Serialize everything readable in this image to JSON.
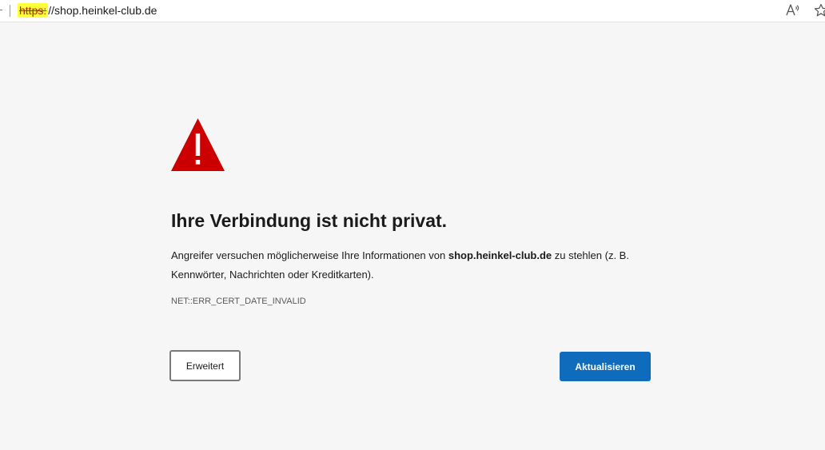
{
  "address_bar": {
    "url_scheme": "https:",
    "url_rest": "//shop.heinkel-club.de",
    "icons": [
      "read-aloud-icon",
      "favorite-star-icon"
    ]
  },
  "warning": {
    "icon": "warning-triangle-icon",
    "icon_color": "#cc0000",
    "title": "Ihre Verbindung ist nicht privat.",
    "description_before": "Angreifer versuchen möglicherweise Ihre Informationen von ",
    "description_domain": "shop.heinkel-club.de",
    "description_after": " zu stehlen (z. B. Kennwörter, Nachrichten oder Kreditkarten).",
    "error_code": "NET::ERR_CERT_DATE_INVALID"
  },
  "buttons": {
    "advanced_label": "Erweitert",
    "reload_label": "Aktualisieren",
    "reload_color": "#0f6cbd"
  }
}
